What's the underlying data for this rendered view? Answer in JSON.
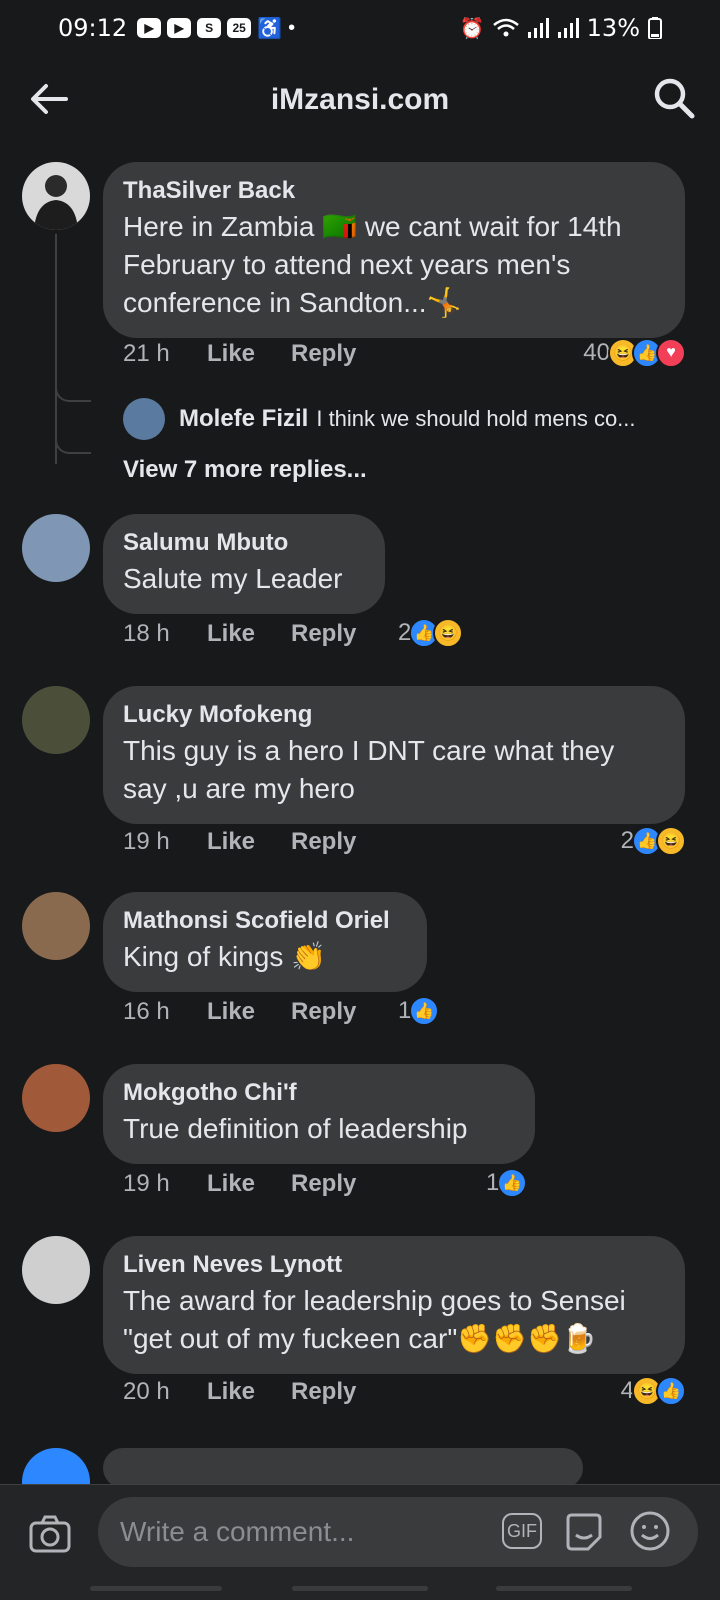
{
  "status_bar": {
    "time": "09:12",
    "badge_s": "S",
    "badge_cal": "25",
    "battery": "13%"
  },
  "header": {
    "title": "iMzansi.com"
  },
  "comments": [
    {
      "name": "ThaSilver Back",
      "text": "Here in Zambia 🇿🇲 we cant wait for 14th February to attend next years men's conference in Sandton...🤸",
      "time": "21 h",
      "like": "Like",
      "reply": "Reply",
      "reaction_count": "40",
      "reactions": [
        "haha",
        "like",
        "love"
      ]
    },
    {
      "name": "Salumu Mbuto",
      "text": "Salute my Leader",
      "time": "18 h",
      "like": "Like",
      "reply": "Reply",
      "reaction_count": "2",
      "reactions": [
        "like",
        "haha"
      ]
    },
    {
      "name": "Lucky Mofokeng",
      "text": "This guy is a hero I DNT care what they say ,u are my hero",
      "time": "19 h",
      "like": "Like",
      "reply": "Reply",
      "reaction_count": "2",
      "reactions": [
        "like",
        "haha"
      ]
    },
    {
      "name": "Mathonsi Scofield Oriel",
      "text": "King of kings 👏",
      "time": "16 h",
      "like": "Like",
      "reply": "Reply",
      "reaction_count": "1",
      "reactions": [
        "like"
      ]
    },
    {
      "name": "Mokgotho Chi'f",
      "text": "True  definition of leadership",
      "time": "19 h",
      "like": "Like",
      "reply": "Reply",
      "reaction_count": "1",
      "reactions": [
        "like"
      ]
    },
    {
      "name": "Liven Neves Lynott",
      "text": "The award for leadership goes to Sensei \"get out of my fuckeen car\"✊✊✊🍺",
      "time": "20 h",
      "like": "Like",
      "reply": "Reply",
      "reaction_count": "4",
      "reactions": [
        "haha",
        "like"
      ]
    }
  ],
  "reply_preview": {
    "name": "Molefe Fizil",
    "snippet": "I think we should hold mens co...",
    "view_more": "View 7 more replies..."
  },
  "composer": {
    "placeholder": "Write a comment...",
    "gif_label": "GIF"
  },
  "colors": {
    "background": "#18191a",
    "bubble": "#3a3b3c",
    "like_blue": "#2d88ff",
    "haha_yellow": "#f7b928",
    "love_red": "#f33e58"
  }
}
